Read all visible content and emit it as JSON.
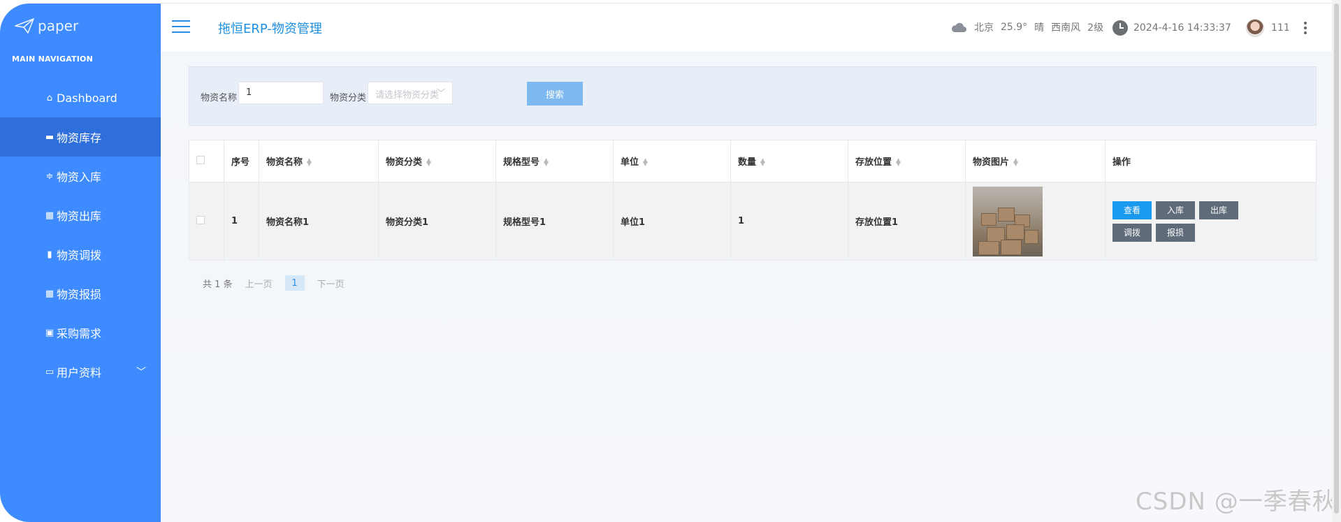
{
  "sidebar": {
    "logo_text": "paper",
    "section_header": "MAIN NAVIGATION",
    "items": [
      {
        "label": "Dashboard",
        "icon": "home-icon"
      },
      {
        "label": "物资库存",
        "icon": "briefcase-icon",
        "active": true
      },
      {
        "label": "物资入库",
        "icon": "sliders-icon"
      },
      {
        "label": "物资出库",
        "icon": "grid-icon"
      },
      {
        "label": "物资调拨",
        "icon": "bar-chart-icon"
      },
      {
        "label": "物资报损",
        "icon": "grid-icon"
      },
      {
        "label": "采购需求",
        "icon": "clipboard-icon"
      },
      {
        "label": "用户资料",
        "icon": "card-icon",
        "expandable": true
      }
    ]
  },
  "header": {
    "title": "拖恒ERP-物资管理",
    "weather": {
      "city": "北京",
      "temperature": "25.9°",
      "condition": "晴",
      "wind": "西南风",
      "level": "2级"
    },
    "datetime": "2024-4-16 14:33:37",
    "username": "111"
  },
  "search": {
    "name_label": "物资名称",
    "name_value": "1",
    "category_label": "物资分类",
    "category_placeholder": "请选择物资分类",
    "search_button": "搜索"
  },
  "table": {
    "columns": [
      "序号",
      "物资名称",
      "物资分类",
      "规格型号",
      "单位",
      "数量",
      "存放位置",
      "物资图片",
      "操作"
    ],
    "rows": [
      {
        "index": "1",
        "name": "物资名称1",
        "category": "物资分类1",
        "spec": "规格型号1",
        "unit": "单位1",
        "quantity": "1",
        "location": "存放位置1",
        "actions": [
          "查看",
          "入库",
          "出库",
          "调拨",
          "报损"
        ]
      }
    ]
  },
  "pagination": {
    "total": "共 1 条",
    "prev": "上一页",
    "current": "1",
    "next": "下一页"
  },
  "watermark": "CSDN @一季春秋",
  "colors": {
    "sidebar": "#3d8bff",
    "sidebar_active": "#2f6fdb",
    "accent": "#1e8fe1",
    "primary_button": "#1a9aef",
    "gray_button": "#5f6b78"
  }
}
